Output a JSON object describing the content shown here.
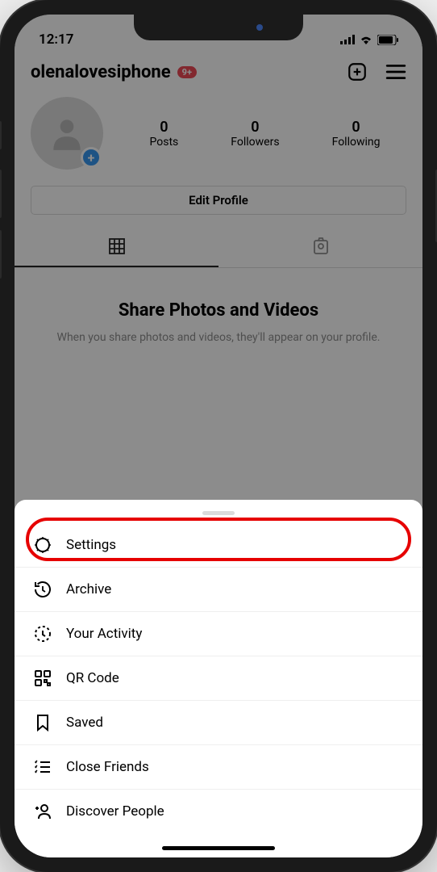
{
  "status": {
    "time": "12:17"
  },
  "header": {
    "username": "olenalovesiphone",
    "badge": "9+"
  },
  "stats": {
    "posts": {
      "count": "0",
      "label": "Posts"
    },
    "followers": {
      "count": "0",
      "label": "Followers"
    },
    "following": {
      "count": "0",
      "label": "Following"
    }
  },
  "edit_profile": "Edit Profile",
  "empty": {
    "title": "Share Photos and Videos",
    "subtitle": "When you share photos and videos, they'll appear on your profile."
  },
  "menu": {
    "settings": "Settings",
    "archive": "Archive",
    "activity": "Your Activity",
    "qr": "QR Code",
    "saved": "Saved",
    "close_friends": "Close Friends",
    "discover": "Discover People"
  }
}
